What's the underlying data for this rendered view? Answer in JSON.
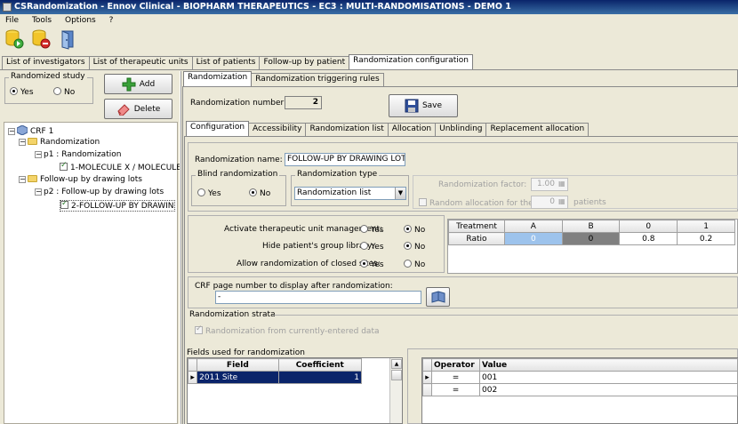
{
  "window": {
    "title": "CSRandomization - Ennov Clinical - BIOPHARM THERAPEUTICS - EC3 : MULTI-RANDOMISATIONS - DEMO 1"
  },
  "menu": [
    "File",
    "Tools",
    "Options",
    "?"
  ],
  "toolbar": {
    "icons": [
      "db-add-icon",
      "db-remove-icon",
      "exit-door-icon"
    ]
  },
  "main_tabs": [
    "List of investigators",
    "List of therapeutic units",
    "List of patients",
    "Follow-up by patient",
    "Randomization configuration"
  ],
  "randomized_study": {
    "label": "Randomized study",
    "yes": "Yes",
    "no": "No"
  },
  "buttons": {
    "add": "Add",
    "delete": "Delete",
    "save": "Save"
  },
  "tree": {
    "root": "CRF 1",
    "n1": "Randomization",
    "n2": "p1 : Randomization",
    "n3": "1-MOLECULE X / MOLECULE Y",
    "n4": "Follow-up by drawing lots",
    "n5": "p2 : Follow-up by drawing lots",
    "n6": "2-FOLLOW-UP BY DRAWING LO"
  },
  "right_tabs": [
    "Randomization",
    "Randomization triggering rules"
  ],
  "rand_number": {
    "label": "Randomization number:",
    "value": "2"
  },
  "config_tabs": [
    "Configuration",
    "Accessibility",
    "Randomization list",
    "Allocation",
    "Unblinding",
    "Replacement allocation"
  ],
  "config": {
    "name_label": "Randomization name:",
    "name_value": "FOLLOW-UP BY DRAWING LOTS",
    "blind_label": "Blind randomization",
    "yes": "Yes",
    "no": "No",
    "type_label": "Randomization type",
    "type_value": "Randomization list",
    "factor_label": "Randomization factor:",
    "factor_value": "1.00",
    "first_label": "Random allocation for the first",
    "first_value": "0",
    "patients_label": "patients",
    "activate_label": "Activate therapeutic unit management:",
    "hide_label": "Hide patient's group library:",
    "allow_label": "Allow randomization of closed sites:",
    "crf_label": "CRF page number to display after randomization:",
    "crf_value": "-",
    "strata_label": "Randomization strata",
    "strata_check": "Randomization from currently-entered data",
    "fields_label": "Fields used for randomization"
  },
  "treatment_table": {
    "headers": [
      "Treatment",
      "A",
      "B",
      "0",
      "1"
    ],
    "row_label": "Ratio",
    "values": [
      "0",
      "0",
      "0.8",
      "0.2"
    ]
  },
  "fields_table": {
    "headers": [
      "Field",
      "Coefficient"
    ],
    "rows": [
      {
        "field": "2011 Site",
        "coefficient": "1"
      }
    ]
  },
  "operator_table": {
    "headers": [
      "Operator",
      "Value"
    ],
    "rows": [
      {
        "operator": "=",
        "value": "001"
      },
      {
        "operator": "=",
        "value": "002"
      }
    ]
  }
}
